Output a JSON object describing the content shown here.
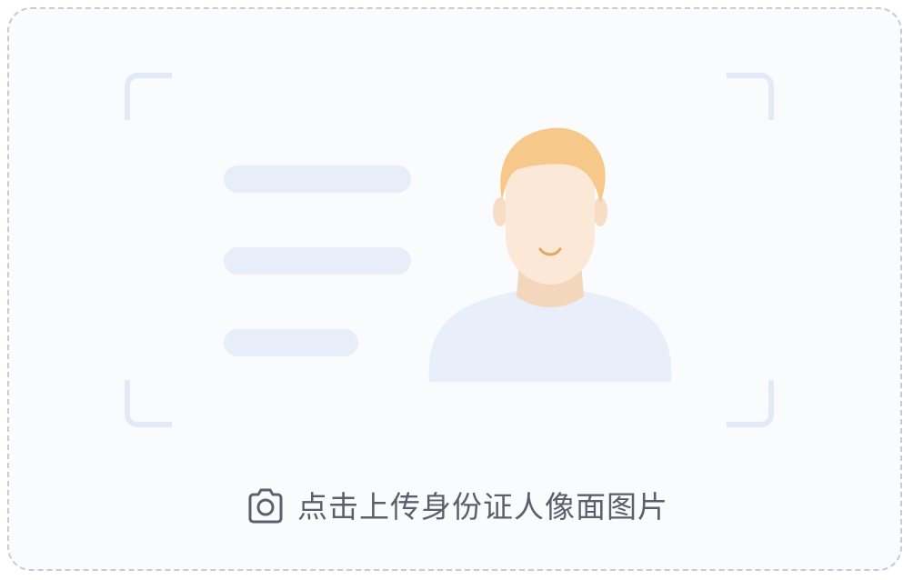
{
  "upload": {
    "caption": "点击上传身份证人像面图片",
    "icon": "camera-icon"
  },
  "colors": {
    "border": "#c6cbd6",
    "card_background": "#fafbfd",
    "placeholder": "#e8eef9",
    "skin": "#fbe8d6",
    "hair": "#f6c98a",
    "shirt": "#e9effa",
    "text": "#5a5f6d"
  }
}
